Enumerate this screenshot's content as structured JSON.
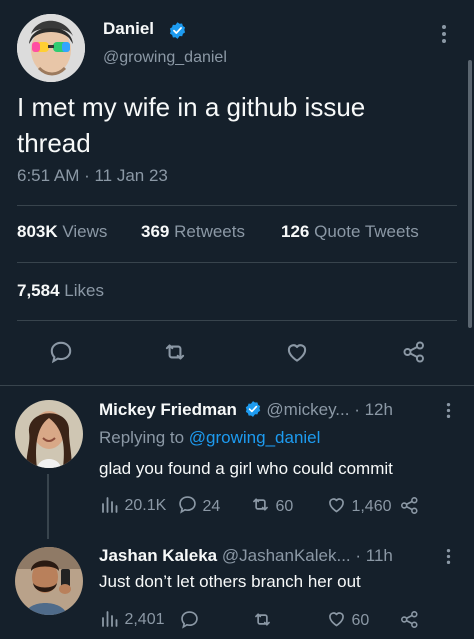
{
  "tweet": {
    "author_name": "Daniel",
    "author_handle": "@growing_daniel",
    "text": "I met my wife in a github issue thread",
    "timestamp": "6:51 AM · 11 Jan 23",
    "views_count": "803K",
    "views_label": "Views",
    "retweets_count": "369",
    "retweets_label": "Retweets",
    "quotes_count": "126",
    "quotes_label": "Quote Tweets",
    "likes_count": "7,584",
    "likes_label": "Likes"
  },
  "replies": [
    {
      "author_name": "Mickey Friedman",
      "author_handle": "@mickey...",
      "time": "· 12h",
      "replying_prefix": "Replying to",
      "replying_to": "@growing_daniel",
      "text": "glad you found a girl who could commit",
      "views": "20.1K",
      "comments": "24",
      "retweets": "60",
      "likes": "1,460"
    },
    {
      "author_name": "Jashan Kaleka",
      "author_handle": "@JashanKalek...",
      "time": "· 11h",
      "text": "Just don’t let others branch her out",
      "views": "2,401",
      "likes": "60"
    }
  ],
  "colors": {
    "background": "#15202b",
    "text": "#f7f9f9",
    "muted": "#8b98a5",
    "accent": "#1d9bf0",
    "divider": "#38444d"
  },
  "icons": [
    "verified-badge-icon",
    "more-icon",
    "reply-icon",
    "retweet-icon",
    "like-icon",
    "share-icon",
    "views-icon"
  ]
}
